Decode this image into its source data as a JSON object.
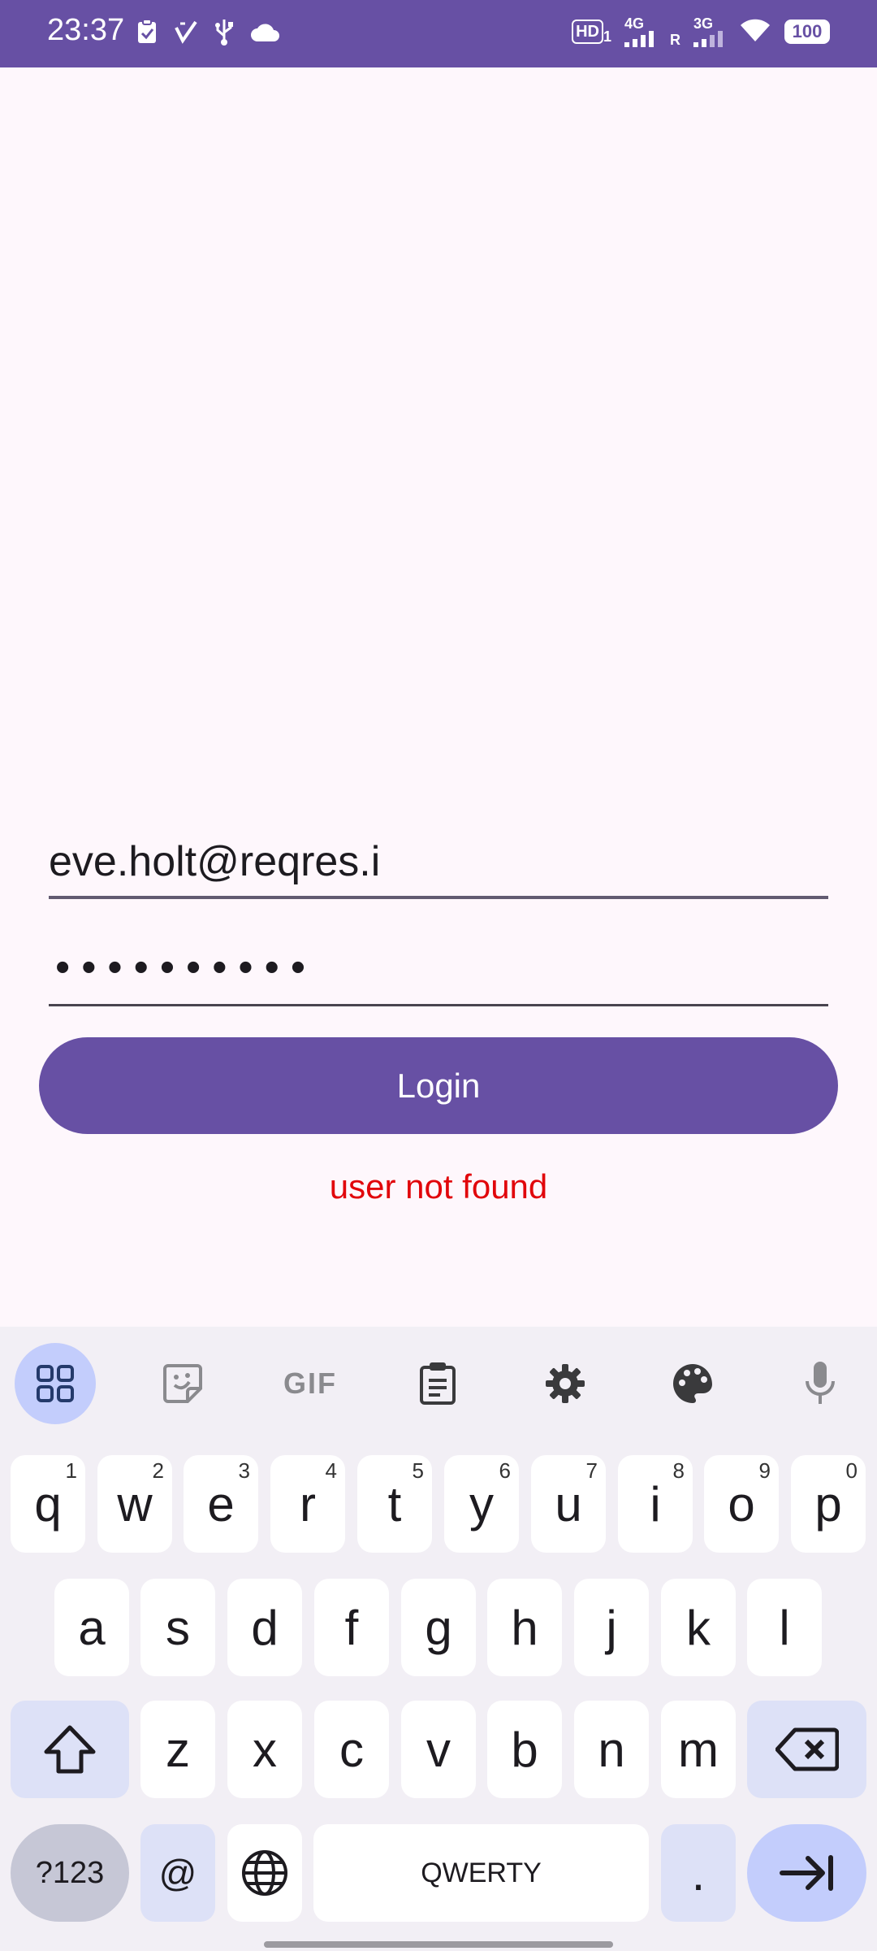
{
  "status_bar": {
    "time": "23:37",
    "left_icons": [
      "clipboard-check-icon",
      "checkmark-icon",
      "usb-icon",
      "cloud-icon"
    ],
    "network": {
      "hd_label": "HD",
      "hd_sub": "1",
      "sim1_label": "4G",
      "sim2_label": "3G",
      "roaming_label": "R"
    },
    "battery_level": "100"
  },
  "form": {
    "email_value": "eve.holt@reqres.i",
    "password_mask": "••••••••••",
    "login_label": "Login",
    "error_message": "user not found"
  },
  "colors": {
    "primary": "#6750a4",
    "error": "#e1060b",
    "background": "#fef7fc"
  },
  "keyboard": {
    "toolbar": [
      "apps-grid-icon",
      "sticker-icon",
      "GIF",
      "clipboard-icon",
      "settings-gear-icon",
      "palette-icon",
      "microphone-icon"
    ],
    "row1": [
      {
        "k": "q",
        "n": "1"
      },
      {
        "k": "w",
        "n": "2"
      },
      {
        "k": "e",
        "n": "3"
      },
      {
        "k": "r",
        "n": "4"
      },
      {
        "k": "t",
        "n": "5"
      },
      {
        "k": "y",
        "n": "6"
      },
      {
        "k": "u",
        "n": "7"
      },
      {
        "k": "i",
        "n": "8"
      },
      {
        "k": "o",
        "n": "9"
      },
      {
        "k": "p",
        "n": "0"
      }
    ],
    "row2": [
      "a",
      "s",
      "d",
      "f",
      "g",
      "h",
      "j",
      "k",
      "l"
    ],
    "row3": [
      "z",
      "x",
      "c",
      "v",
      "b",
      "n",
      "m"
    ],
    "row4": {
      "symbols": "?123",
      "at": "@",
      "space": "QWERTY",
      "period": "."
    }
  }
}
